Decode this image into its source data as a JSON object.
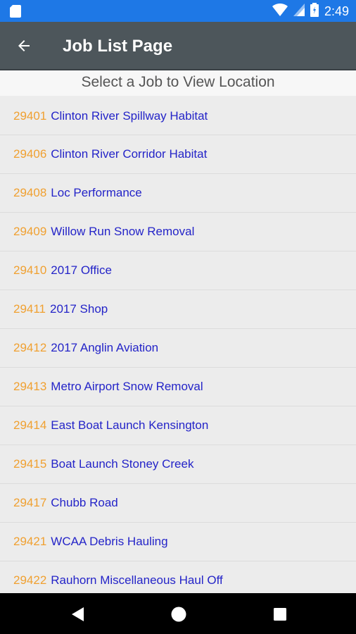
{
  "status_bar": {
    "time": "2:49",
    "icons": [
      "sd-card-icon",
      "wifi-icon",
      "signal-icon",
      "battery-icon"
    ],
    "color": "#1e78e6"
  },
  "app_bar": {
    "title": "Job List Page",
    "back_icon": "arrow-left-icon",
    "color": "#4d565b"
  },
  "subheader": {
    "text": "Select a Job to View Location"
  },
  "colors": {
    "job_number": "#f0a030",
    "job_name": "#2424c8"
  },
  "jobs": [
    {
      "number": "29401",
      "name": "Clinton River Spillway Habitat"
    },
    {
      "number": "29406",
      "name": "Clinton River Corridor Habitat"
    },
    {
      "number": "29408",
      "name": "Loc Performance"
    },
    {
      "number": "29409",
      "name": "Willow Run Snow Removal"
    },
    {
      "number": "29410",
      "name": "2017 Office"
    },
    {
      "number": "29411",
      "name": "2017 Shop"
    },
    {
      "number": "29412",
      "name": "2017 Anglin Aviation"
    },
    {
      "number": "29413",
      "name": "Metro Airport Snow Removal"
    },
    {
      "number": "29414",
      "name": "East Boat Launch Kensington"
    },
    {
      "number": "29415",
      "name": "Boat Launch Stoney Creek"
    },
    {
      "number": "29417",
      "name": "Chubb Road"
    },
    {
      "number": "29421",
      "name": "WCAA Debris Hauling"
    },
    {
      "number": "29422",
      "name": "Rauhorn Miscellaneous Haul Off"
    }
  ],
  "nav_bar": {
    "icons": [
      "back-triangle-icon",
      "home-circle-icon",
      "recents-square-icon"
    ]
  }
}
